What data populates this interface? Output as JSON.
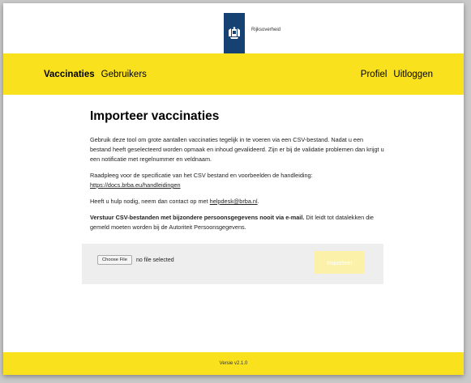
{
  "header": {
    "logo_text": "Rijksoverheid",
    "logo_icon": "coat-of-arms"
  },
  "nav": {
    "left": [
      "Vaccinaties",
      "Gebruikers"
    ],
    "right": [
      "Profiel",
      "Uitloggen"
    ]
  },
  "main": {
    "title": "Importeer vaccinaties",
    "p1": "Gebruik deze tool om grote aantallen vaccinaties tegelijk in te voeren via een CSV-bestand. Nadat u een bestand heeft geselecteerd worden opmaak en inhoud gevalideerd. Zijn er bij de validatie problemen dan krijgt u een notificatie met regelnummer en veldnaam.",
    "p2_text": "Raadpleeg voor de specificatie van het CSV bestand en voorbeelden de handleiding:",
    "p2_link": "https://docs.brba.eu/handleidingen",
    "p3_text": "Heeft u hulp nodig, neem dan contact op met",
    "p3_link": "helpdesk@brba.nl",
    "p3_end": ".",
    "p4_bold": "Verstuur CSV-bestanden met bijzondere persoonsgegevens nooit via e-mail.",
    "p4_rest": " Dit leidt tot datalekken die gemeld moeten worden bij de Autoriteit Persoonsgegevens."
  },
  "upload": {
    "choose_label": "Choose File",
    "no_file": "no file selected",
    "import_label": "Importeer"
  },
  "footer": {
    "version": "Versie v2.1.0"
  },
  "colors": {
    "brand_yellow": "#f9e11e",
    "logo_blue": "#154273"
  }
}
